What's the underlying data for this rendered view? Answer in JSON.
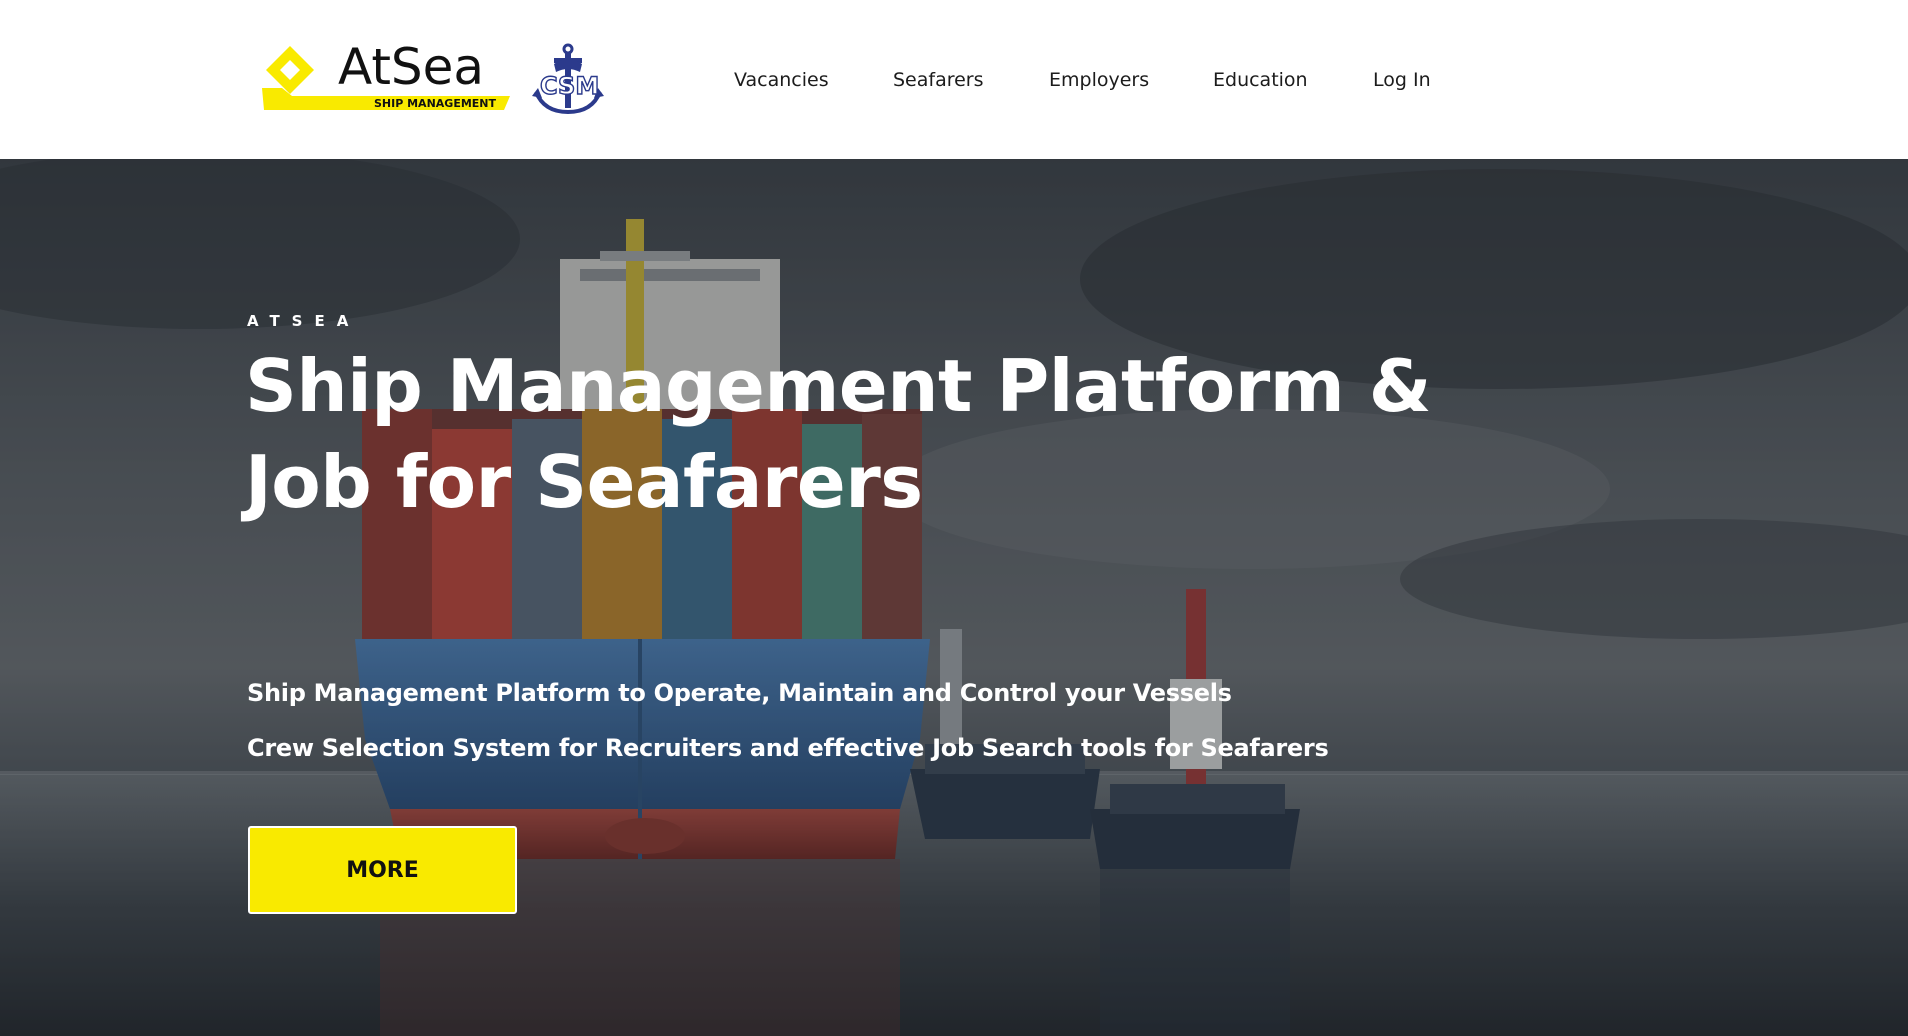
{
  "header": {
    "logo_atsea": {
      "wordmark": "AtSea",
      "tagline": "SHIP MANAGEMENT",
      "accent_color": "#f9ea00"
    },
    "logo_csm": {
      "wordmark": "CSM",
      "color": "#2b3a8c",
      "icon": "anchor-icon"
    },
    "nav": [
      {
        "label": "Vacancies"
      },
      {
        "label": "Seafarers"
      },
      {
        "label": "Employers"
      },
      {
        "label": "Education"
      },
      {
        "label": "Log In"
      }
    ]
  },
  "hero": {
    "eyebrow": "ATSEA",
    "title_line_1": "Ship Management Platform &",
    "title_line_2": "Job for Seafarers",
    "subtitle_1": "Ship Management Platform to Operate, Maintain and Control your Vessels",
    "subtitle_2": "Crew Selection System for Recruiters and effective Job Search tools for Seafarers",
    "cta_label": "MORE",
    "cta_color": "#f9ea00",
    "background": "container-ship-with-tugboats-image"
  }
}
